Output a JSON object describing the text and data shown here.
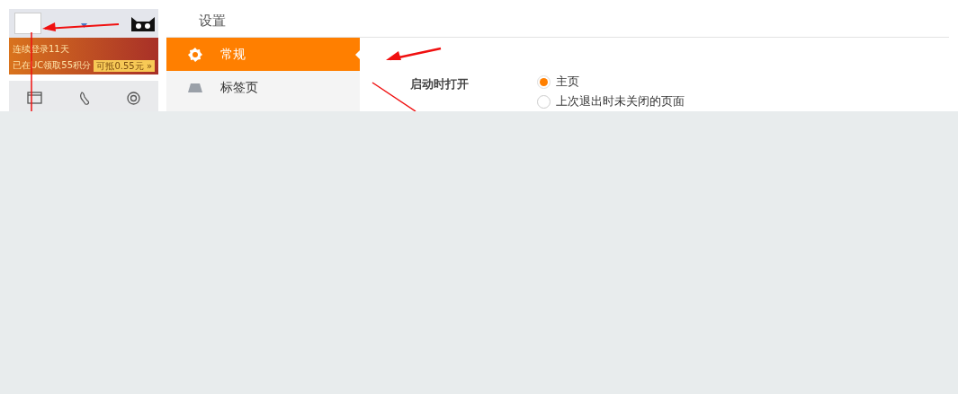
{
  "thumbnail": {
    "banner_lines": [
      "连续登录11天",
      "已在UC领取55积分"
    ],
    "reward_button": "可抵0.55元",
    "reward_arrow": "»"
  },
  "header": {
    "title": "设置"
  },
  "sidebar": {
    "items": [
      {
        "label": "常规",
        "selected": true,
        "kind": "gear"
      },
      {
        "label": "标签页",
        "selected": false,
        "kind": "tab"
      }
    ]
  },
  "settings": [
    {
      "label": "启动时打开",
      "options": [
        {
          "label": "主页",
          "selected": true
        },
        {
          "label": "上次退出时未关闭的页面",
          "selected": false
        }
      ]
    }
  ]
}
